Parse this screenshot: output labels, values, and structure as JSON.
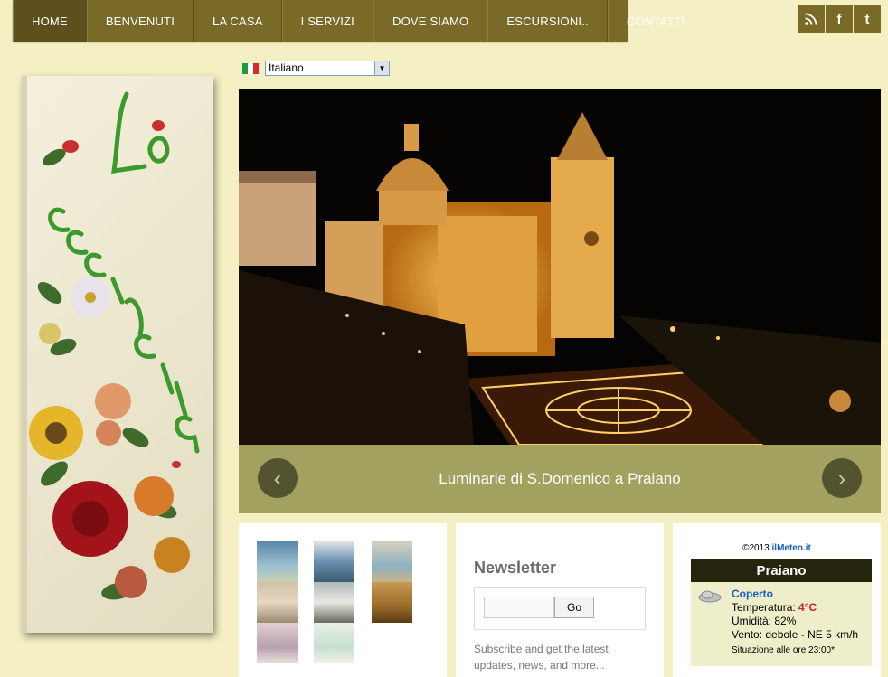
{
  "nav": {
    "items": [
      {
        "label": "HOME",
        "active": true
      },
      {
        "label": "BENVENUTI"
      },
      {
        "label": "LA CASA"
      },
      {
        "label": "I SERVIZI"
      },
      {
        "label": "DOVE SIAMO"
      },
      {
        "label": "ESCURSIONI.."
      },
      {
        "label": "CONTATTI"
      }
    ]
  },
  "social": {
    "rss_icon": "rss-icon",
    "facebook_label": "f",
    "twitter_label": "t"
  },
  "language": {
    "selected": "Italiano"
  },
  "slider": {
    "caption": "Luminarie di S.Domenico a Praiano"
  },
  "newsletter": {
    "title": "Newsletter",
    "go_label": "Go",
    "description": "Subscribe and get the latest updates, news, and more..."
  },
  "meteo": {
    "copyright": "©2013 ",
    "copyright_link": "ilMeteo.it",
    "city": "Praiano",
    "condition": "Coperto",
    "temperature_label": "Temperatura: ",
    "temperature_value": "4°C",
    "humidity": "Umidità: 82%",
    "wind": "Vento: debole - NE 5 km/h",
    "updated": "Situazione alle ore 23:00*"
  },
  "colors": {
    "nav": "#7a6a28",
    "page_bg": "#f5f0c4",
    "caption_bar": "#a3a160",
    "meteo_head": "#25250d"
  }
}
